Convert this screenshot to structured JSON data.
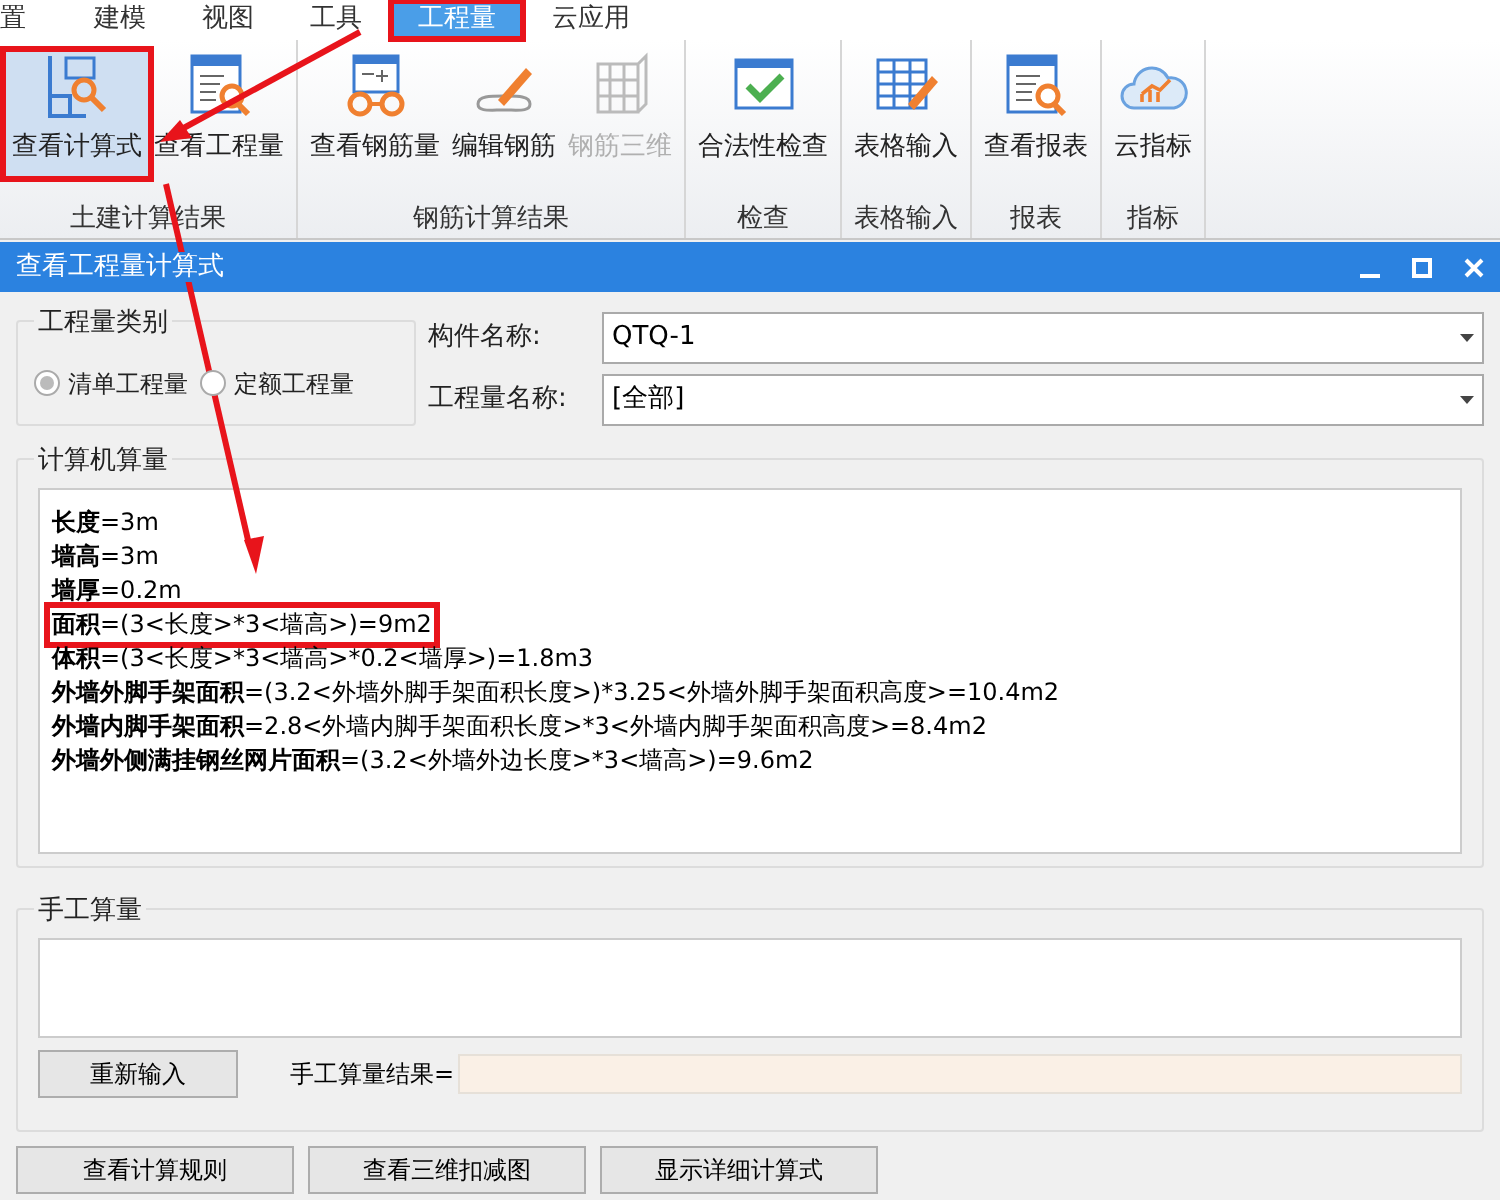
{
  "menu": [
    {
      "label": "置",
      "selected": false,
      "highlighted": false
    },
    {
      "label": "建模",
      "selected": false,
      "highlighted": false
    },
    {
      "label": "视图",
      "selected": false,
      "highlighted": false
    },
    {
      "label": "工具",
      "selected": false,
      "highlighted": false
    },
    {
      "label": "工程量",
      "selected": true,
      "highlighted": true
    },
    {
      "label": "云应用",
      "selected": false,
      "highlighted": false
    }
  ],
  "ribbon_groups": [
    {
      "label": "土建计算结果",
      "buttons": [
        {
          "label": "查看计算式",
          "selected": true,
          "highlighted": true,
          "disabled": false
        },
        {
          "label": "查看工程量",
          "selected": false,
          "highlighted": false,
          "disabled": false
        }
      ]
    },
    {
      "label": "钢筋计算结果",
      "buttons": [
        {
          "label": "查看钢筋量",
          "selected": false,
          "highlighted": false,
          "disabled": false
        },
        {
          "label": "编辑钢筋",
          "selected": false,
          "highlighted": false,
          "disabled": false
        },
        {
          "label": "钢筋三维",
          "selected": false,
          "highlighted": false,
          "disabled": true
        }
      ]
    },
    {
      "label": "检查",
      "buttons": [
        {
          "label": "合法性检查",
          "selected": false,
          "highlighted": false,
          "disabled": false
        }
      ]
    },
    {
      "label": "表格输入",
      "buttons": [
        {
          "label": "表格输入",
          "selected": false,
          "highlighted": false,
          "disabled": false
        }
      ]
    },
    {
      "label": "报表",
      "buttons": [
        {
          "label": "查看报表",
          "selected": false,
          "highlighted": false,
          "disabled": false
        }
      ]
    },
    {
      "label": "指标",
      "buttons": [
        {
          "label": "云指标",
          "selected": false,
          "highlighted": false,
          "disabled": false
        }
      ]
    }
  ],
  "annotation_arrows": true,
  "dialog": {
    "title": "查看工程量计算式",
    "category": {
      "title": "工程量类别",
      "options": [
        {
          "label": "清单工程量",
          "selected": true
        },
        {
          "label": "定额工程量",
          "selected": false
        }
      ]
    },
    "fields": [
      {
        "label": "构件名称:",
        "value": "QTQ-1"
      },
      {
        "label": "工程量名称:",
        "value": "[全部]"
      }
    ],
    "computed": {
      "title": "计算机算量",
      "lines": [
        {
          "text": "**长度**=3m",
          "highlighted": false
        },
        {
          "text": "**墙高**=3m",
          "highlighted": false
        },
        {
          "text": "**墙厚**=0.2m",
          "highlighted": false
        },
        {
          "text": "**面积**=(3<长度>*3<墙高>)=9m2",
          "highlighted": true
        },
        {
          "text": "**体积**=(3<长度>*3<墙高>*0.2<墙厚>)=1.8m3",
          "highlighted": false
        },
        {
          "text": "**外墙外脚手架面积**=(3.2<外墙外脚手架面积长度>)*3.25<外墙外脚手架面积高度>=10.4m2",
          "highlighted": false
        },
        {
          "text": "**外墙内脚手架面积**=2.8<外墙内脚手架面积长度>*3<外墙内脚手架面积高度>=8.4m2",
          "highlighted": false
        },
        {
          "text": "**外墙外侧满挂钢丝网片面积**=(3.2<外墙外边长度>*3<墙高>)=9.6m2",
          "highlighted": false
        }
      ]
    },
    "manual": {
      "title": "手工算量",
      "reset_button": "重新输入",
      "result_label": "手工算量结果="
    },
    "buttons": [
      "查看计算规则",
      "查看三维扣减图",
      "显示详细计算式"
    ]
  }
}
